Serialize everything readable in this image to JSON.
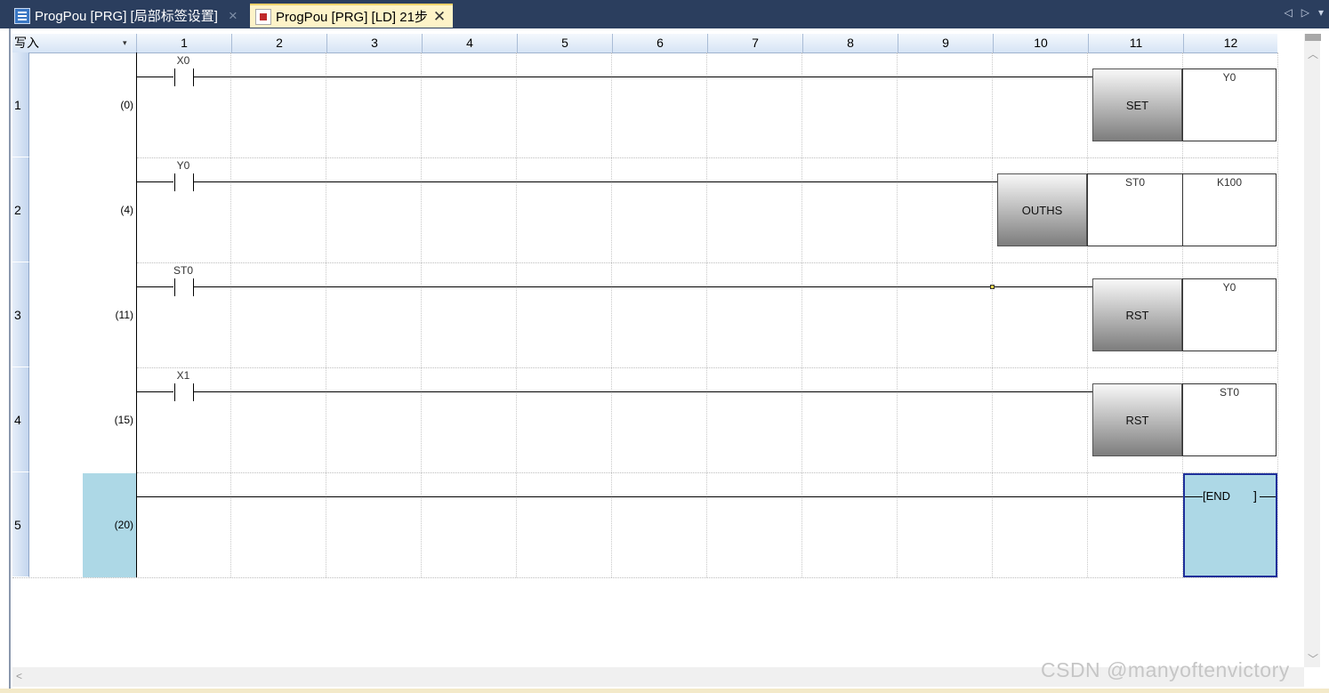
{
  "tabs": [
    {
      "title": "ProgPou [PRG] [局部标签设置]",
      "close": "×"
    },
    {
      "title": "ProgPou [PRG] [LD] 21步",
      "close": "✕"
    }
  ],
  "tab_nav": {
    "prev": "◁",
    "next": "▷",
    "menu": "▾"
  },
  "editor": {
    "mode_label": "写入",
    "mode_dropdown": "▾",
    "columns": [
      "1",
      "2",
      "3",
      "4",
      "5",
      "6",
      "7",
      "8",
      "9",
      "10",
      "11",
      "12"
    ]
  },
  "rungs": [
    {
      "row": "1",
      "step": "(0)",
      "contact": "X0",
      "instruction": "SET",
      "operands": [
        "Y0"
      ]
    },
    {
      "row": "2",
      "step": "(4)",
      "contact": "Y0",
      "instruction": "OUTHS",
      "operands": [
        "ST0",
        "K100"
      ]
    },
    {
      "row": "3",
      "step": "(11)",
      "contact": "ST0",
      "instruction": "RST",
      "operands": [
        "Y0"
      ]
    },
    {
      "row": "4",
      "step": "(15)",
      "contact": "X1",
      "instruction": "RST",
      "operands": [
        "ST0"
      ]
    },
    {
      "row": "5",
      "step": "(20)",
      "end_label": "[END",
      "end_bracket": "]"
    }
  ],
  "watermark": "CSDN @manyoftenvictory",
  "colors": {
    "tab_bar": "#2b3e5e",
    "active_tab": "#fdf3c8",
    "selection": "#add8e6",
    "cursor_border": "#1e2f9a"
  }
}
